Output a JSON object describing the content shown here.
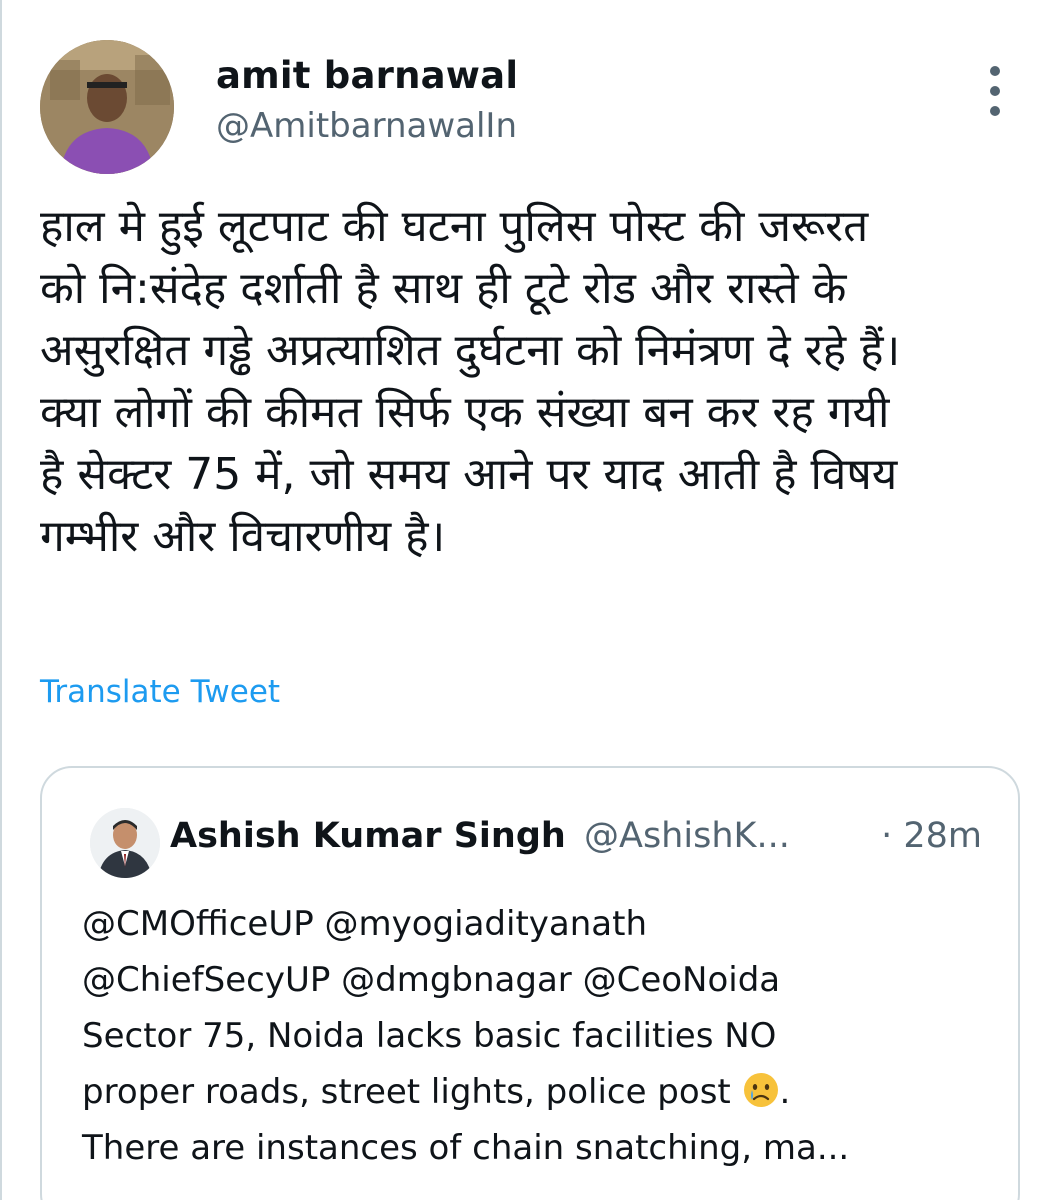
{
  "tweet": {
    "author": {
      "name": "amit barnawal",
      "handle": "@AmitbarnawalIn"
    },
    "text_lines": [
      "हाल मे हुई लूटपाट की घटना पुलिस पोस्ट की जरूरत",
      "को नि:संदेह दर्शाती है साथ ही टूटे रोड और रास्ते के",
      "असुरक्षित गड्ढे अप्रत्याशित दुर्घटना को निमंत्रण दे रहे हैं।",
      "क्या लोगों की कीमत सिर्फ एक संख्या बन कर रह गयी",
      "है सेक्टर 75 में, जो समय आने पर याद आती है विषय",
      "गम्भीर और विचारणीय है।"
    ],
    "translate_label": "Translate Tweet",
    "more_icon": "more-vertical-icon"
  },
  "quote": {
    "author": {
      "name": "Ashish Kumar Singh",
      "handle": "@AshishK...",
      "time": "· 28m"
    },
    "text_lines": {
      "l1": "@CMOfficeUP @myogiadityanath",
      "l2": "@ChiefSecyUP @dmgbnagar @CeoNoida",
      "l3": "Sector 75, Noida lacks basic facilities NO",
      "l4a": "proper roads, street lights, police post ",
      "l4b": ".",
      "l5": "There are instances of chain snatching, ma..."
    },
    "emoji": "crying-face-icon"
  },
  "colors": {
    "text": "#0f1419",
    "secondary": "#536471",
    "link": "#1d9bf0",
    "border": "#cfd9de"
  }
}
